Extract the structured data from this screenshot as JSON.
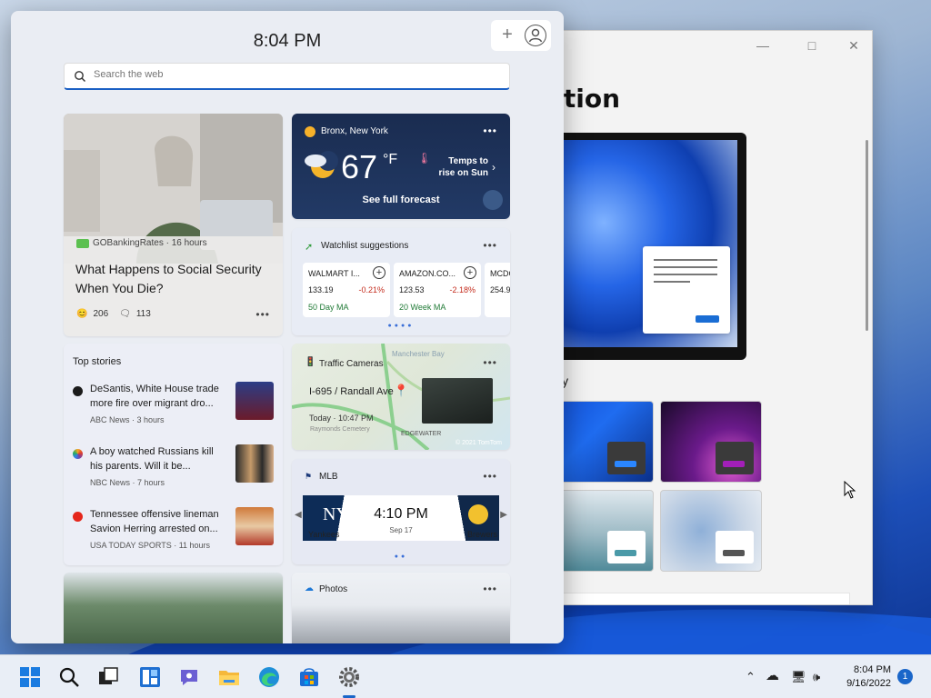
{
  "widgets": {
    "time": "8:04 PM",
    "search": {
      "placeholder": "Search the web"
    },
    "news": {
      "source": "GOBankingRates · 16 hours",
      "headline": "What Happens to Social Security When You Die?",
      "reactions": "206",
      "comments": "113"
    },
    "weather": {
      "location": "Bronx, New York",
      "temp": "67",
      "unit": "°F",
      "tip": "Temps to rise on Sun",
      "forecast_link": "See full forecast"
    },
    "watchlist": {
      "title": "Watchlist suggestions",
      "stocks": [
        {
          "name": "WALMART I...",
          "price": "133.19",
          "change": "-0.21%",
          "ma": "50 Day MA"
        },
        {
          "name": "AMAZON.CO...",
          "price": "123.53",
          "change": "-2.18%",
          "ma": "20 Week MA"
        },
        {
          "name": "MCDO",
          "price": "254.9",
          "change": "",
          "ma": ""
        }
      ]
    },
    "top_stories": {
      "title": "Top stories",
      "items": [
        {
          "title": "DeSantis, White House trade more fire over migrant dro...",
          "source": "ABC News · 3 hours"
        },
        {
          "title": "A boy watched Russians kill his parents. Will it be...",
          "source": "NBC News · 7 hours"
        },
        {
          "title": "Tennessee offensive lineman Savion Herring arrested on...",
          "source": "USA TODAY SPORTS · 11 hours"
        }
      ]
    },
    "traffic": {
      "title": "Traffic Cameras",
      "route": "I-695 / Randall Ave",
      "when": "Today · 10:47 PM",
      "map_labels": [
        "Manchester Bay",
        "Raymonds Cemetery",
        "EDGEWATER"
      ],
      "copyright": "© 2021 TomTom"
    },
    "mlb": {
      "title": "MLB",
      "time": "4:10 PM",
      "date": "Sep 17",
      "home": "Yankees",
      "away": "Brewers"
    },
    "photos": {
      "title": "Photos"
    }
  },
  "settings": {
    "title_fragment": "ation",
    "apply_fragment": "ly"
  },
  "taskbar": {
    "time": "8:04 PM",
    "date": "9/16/2022",
    "notifications": "1"
  }
}
